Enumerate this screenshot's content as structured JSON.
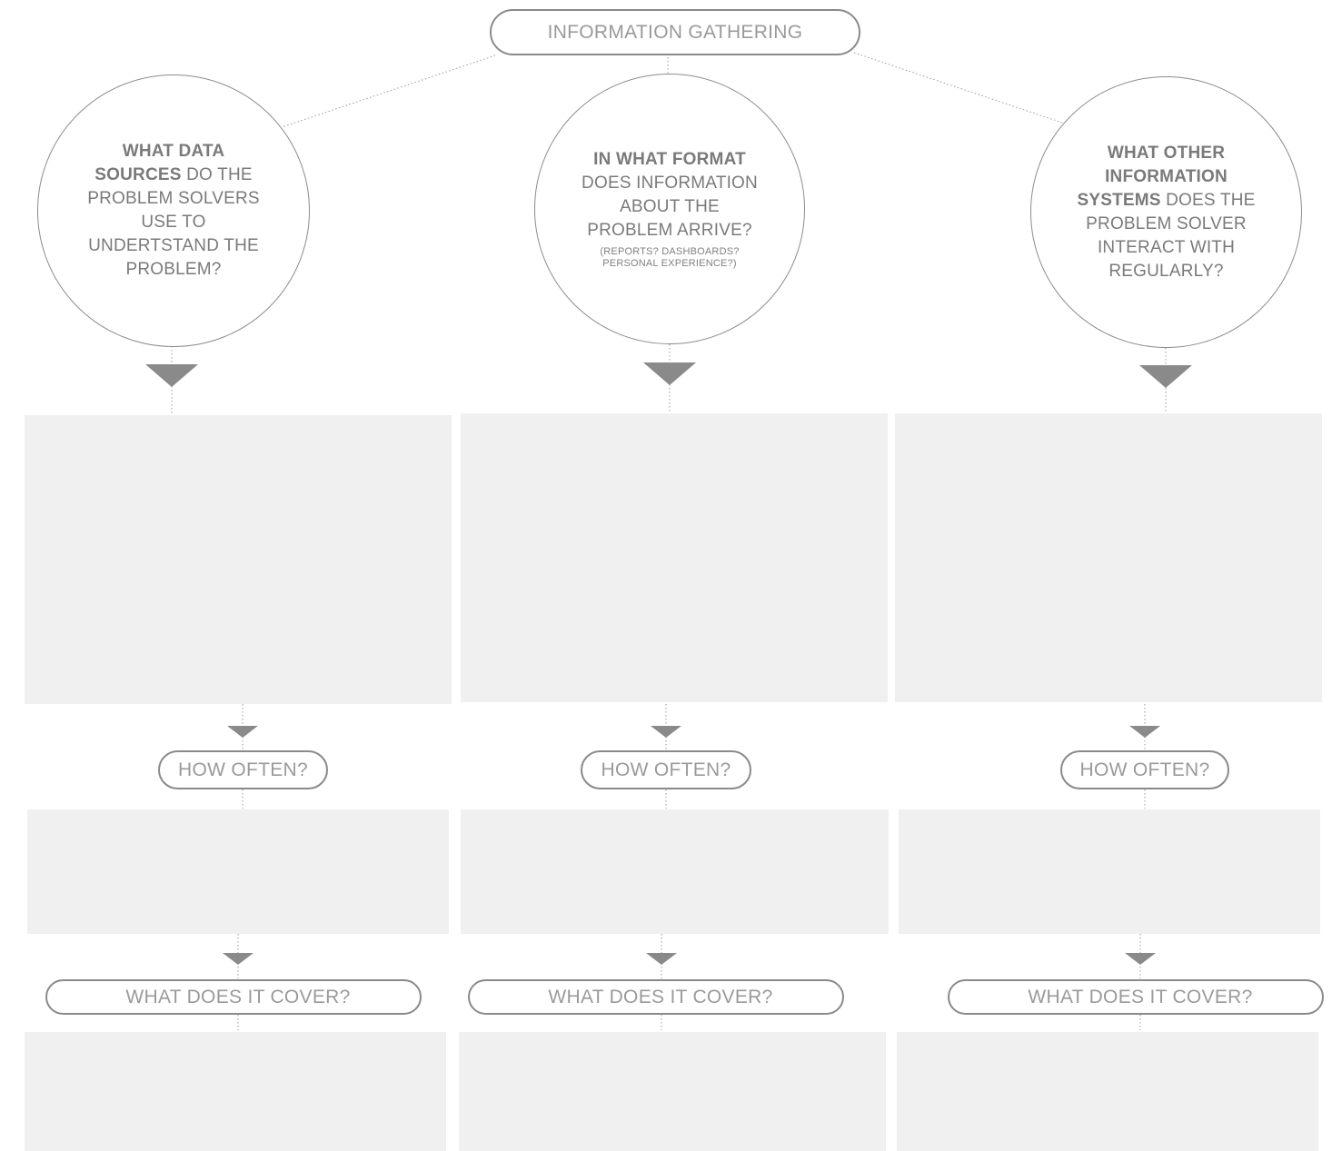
{
  "top_label": "INFORMATION GATHERING",
  "questions": [
    {
      "bold_1": "WHAT DATA",
      "bold_2": "SOURCES",
      "line_2_rest": " DO THE",
      "line_3": "PROBLEM SOLVERS",
      "line_4": "USE TO",
      "line_5": "UNDERTSTAND THE",
      "line_6": "PROBLEM?"
    },
    {
      "bold_1": "IN WHAT FORMAT",
      "line_2": "DOES INFORMATION",
      "line_3": "ABOUT THE",
      "line_4": "PROBLEM ARRIVE?",
      "note_1": "(REPORTS? DASHBOARDS?",
      "note_2": "PERSONAL EXPERIENCE?)"
    },
    {
      "bold_1": "WHAT OTHER",
      "bold_2": "INFORMATION",
      "bold_3": "SYSTEMS",
      "line_3_rest": " DOES THE",
      "line_4": "PROBLEM SOLVER",
      "line_5": "INTERACT WITH",
      "line_6": "REGULARLY?"
    }
  ],
  "how_often_label": "HOW OFTEN?",
  "cover_label": "WHAT DOES IT COVER?",
  "colors": {
    "box_fill": "#f0f0f0",
    "outline": "#8a8a8a",
    "text": "#7a7a7a"
  }
}
